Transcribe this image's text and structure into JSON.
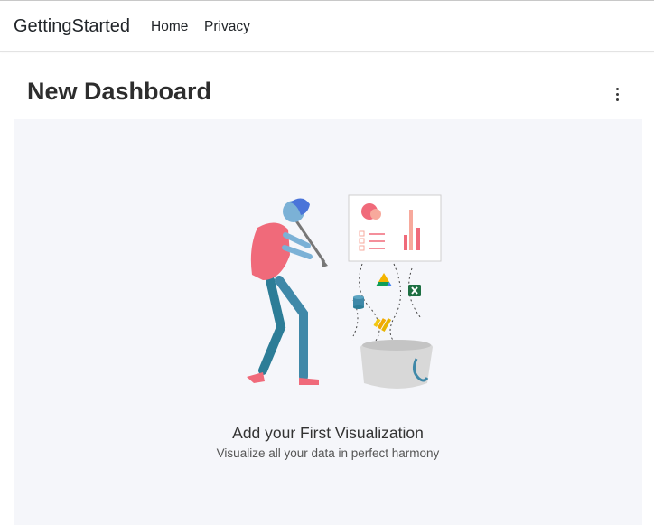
{
  "navbar": {
    "brand": "GettingStarted",
    "links": [
      {
        "label": "Home"
      },
      {
        "label": "Privacy"
      }
    ]
  },
  "dashboard": {
    "title": "New Dashboard",
    "menu_icon": "more-vertical-icon"
  },
  "empty_state": {
    "title": "Add your First Visualization",
    "subtitle": "Visualize all your data in perfect harmony",
    "illustration_icons": [
      "google-drive-icon",
      "excel-icon",
      "database-icon",
      "power-bi-icon"
    ]
  },
  "colors": {
    "canvas_bg": "#f5f6fa",
    "accent_pink": "#f06a7a",
    "accent_blue": "#3f88a8"
  }
}
